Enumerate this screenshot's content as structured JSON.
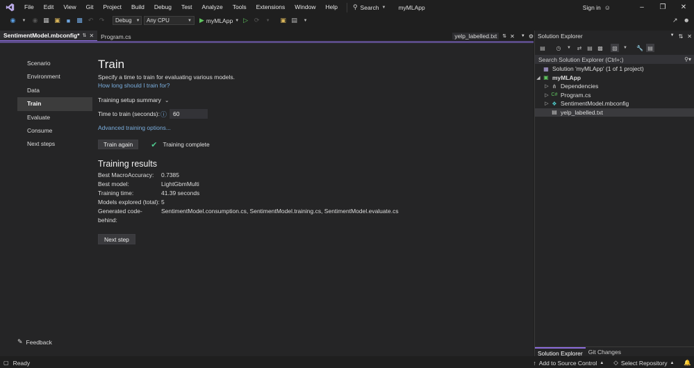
{
  "menu": [
    "File",
    "Edit",
    "View",
    "Git",
    "Project",
    "Build",
    "Debug",
    "Test",
    "Analyze",
    "Tools",
    "Extensions",
    "Window",
    "Help"
  ],
  "search_label": "Search",
  "app_name": "myMLApp",
  "sign_in": "Sign in",
  "toolbar": {
    "config": "Debug",
    "platform": "Any CPU",
    "run_target": "myMLApp"
  },
  "tabs": {
    "active": "SentimentModel.mbconfig*",
    "second": "Program.cs",
    "right": "yelp_labelled.txt"
  },
  "nav": [
    "Scenario",
    "Environment",
    "Data",
    "Train",
    "Evaluate",
    "Consume",
    "Next steps"
  ],
  "nav_selected": "Train",
  "feedback": "Feedback",
  "train": {
    "title": "Train",
    "description": "Specify a time to train for evaluating various models.",
    "how_long_link": "How long should I train for?",
    "setup_summary": "Training setup summary",
    "time_label": "Time to train (seconds):",
    "time_value": "60",
    "advanced_link": "Advanced training options...",
    "train_again": "Train again",
    "status": "Training complete",
    "results_title": "Training results",
    "results": [
      {
        "label": "Best MacroAccuracy:",
        "value": "0.7385"
      },
      {
        "label": "Best model:",
        "value": "LightGbmMulti"
      },
      {
        "label": "Training time:",
        "value": "41.39 seconds"
      },
      {
        "label": "Models explored (total):",
        "value": "5"
      },
      {
        "label": "Generated code-behind:",
        "value": "SentimentModel.consumption.cs, SentimentModel.training.cs, SentimentModel.evaluate.cs"
      }
    ],
    "next_step": "Next step"
  },
  "solution_explorer": {
    "title": "Solution Explorer",
    "search_placeholder": "Search Solution Explorer (Ctrl+;)",
    "solution": "Solution 'myMLApp' (1 of 1 project)",
    "project": "myMLApp",
    "items": [
      "Dependencies",
      "Program.cs",
      "SentimentModel.mbconfig",
      "yelp_labelled.txt"
    ],
    "bottom_tabs": [
      "Solution Explorer",
      "Git Changes"
    ]
  },
  "status": {
    "ready": "Ready",
    "source_control": "Add to Source Control",
    "repository": "Select Repository"
  },
  "colors": {
    "accent": "#8c6cdb",
    "link": "#7aaede",
    "check": "#4ec98f",
    "run": "#5fc35f"
  }
}
